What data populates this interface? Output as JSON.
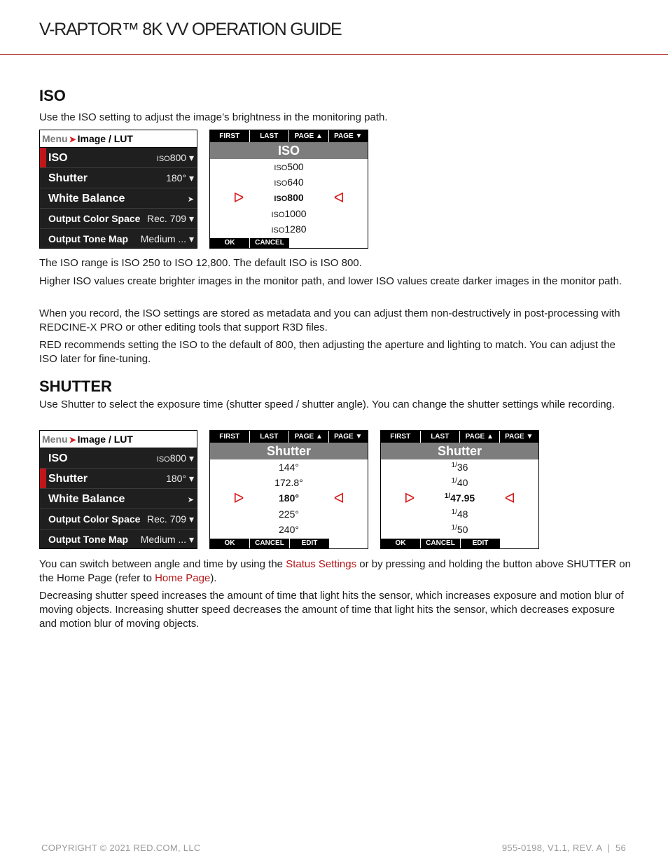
{
  "header": {
    "title": "V-RAPTOR™ 8K VV OPERATION GUIDE"
  },
  "iso_section": {
    "heading": "ISO",
    "intro": "Use the ISO setting to adjust the image’s brightness in the monitoring path.",
    "paragraphs": [
      "The ISO range is ISO 250 to ISO 12,800. The default ISO is ISO 800.",
      "Higher ISO values create brighter images in the monitor path, and lower ISO values create darker images in the monitor path.",
      "When you record, the ISO settings are stored as metadata and you can adjust them non-destructively in post-processing with REDCINE-X PRO or other editing tools that support R3D files.",
      "RED recommends setting the ISO to the default of 800, then adjusting the aperture and lighting to match. You can adjust the ISO later for fine-tuning."
    ]
  },
  "menu": {
    "crumb_root": "Menu",
    "crumb_current": "Image / LUT",
    "rows": [
      {
        "label": "ISO",
        "value_prefix": "ISO",
        "value": "800",
        "chevron": "▾"
      },
      {
        "label": "Shutter",
        "value_prefix": "",
        "value": "180°",
        "chevron": "▾"
      },
      {
        "label": "White Balance",
        "value_prefix": "",
        "value": "",
        "chevron": "➤"
      },
      {
        "label": "Output Color Space",
        "value_prefix": "",
        "value": "Rec. 709",
        "chevron": "▾"
      },
      {
        "label": "Output Tone Map",
        "value_prefix": "",
        "value": "Medium ...",
        "chevron": "▾"
      }
    ]
  },
  "picker_nav": {
    "first": "FIRST",
    "last": "LAST",
    "page_up": "PAGE ▲",
    "page_down": "PAGE ▼",
    "ok": "OK",
    "cancel": "CANCEL",
    "edit": "EDIT"
  },
  "iso_picker": {
    "title": "ISO",
    "prefix": "ISO",
    "options": [
      "500",
      "640",
      "800",
      "1000",
      "1280"
    ],
    "selected_index": 2
  },
  "shutter_section": {
    "heading": "SHUTTER",
    "intro": "Use Shutter to select the exposure time (shutter speed / shutter angle). You can change the shutter settings while recording.",
    "p1_before": "You can switch between angle and time by using the ",
    "p1_link1": "Status Settings",
    "p1_middle": " or by pressing and holding the button above SHUTTER on the Home Page (refer to ",
    "p1_link2": "Home Page",
    "p1_after": ").",
    "p2": "Decreasing shutter speed increases the amount of time that light hits the sensor, which increases exposure and motion blur of moving objects. Increasing shutter speed decreases the amount of time that light hits the sensor, which decreases exposure and motion blur of moving objects."
  },
  "shutter_angle_picker": {
    "title": "Shutter",
    "options": [
      "144°",
      "172.8°",
      "180°",
      "225°",
      "240°"
    ],
    "selected_index": 2
  },
  "shutter_time_picker": {
    "title": "Shutter",
    "numerator": "1/",
    "options": [
      "36",
      "40",
      "47.95",
      "48",
      "50"
    ],
    "selected_index": 2
  },
  "footer": {
    "copyright": "COPYRIGHT © 2021 RED.COM, LLC",
    "doc_ref": "955-0198, V1.1, REV. A  |  56"
  },
  "colors": {
    "accent_red": "#b3191b",
    "selection_red": "#c0161a",
    "title_bar_gray": "#7d7d7d"
  }
}
